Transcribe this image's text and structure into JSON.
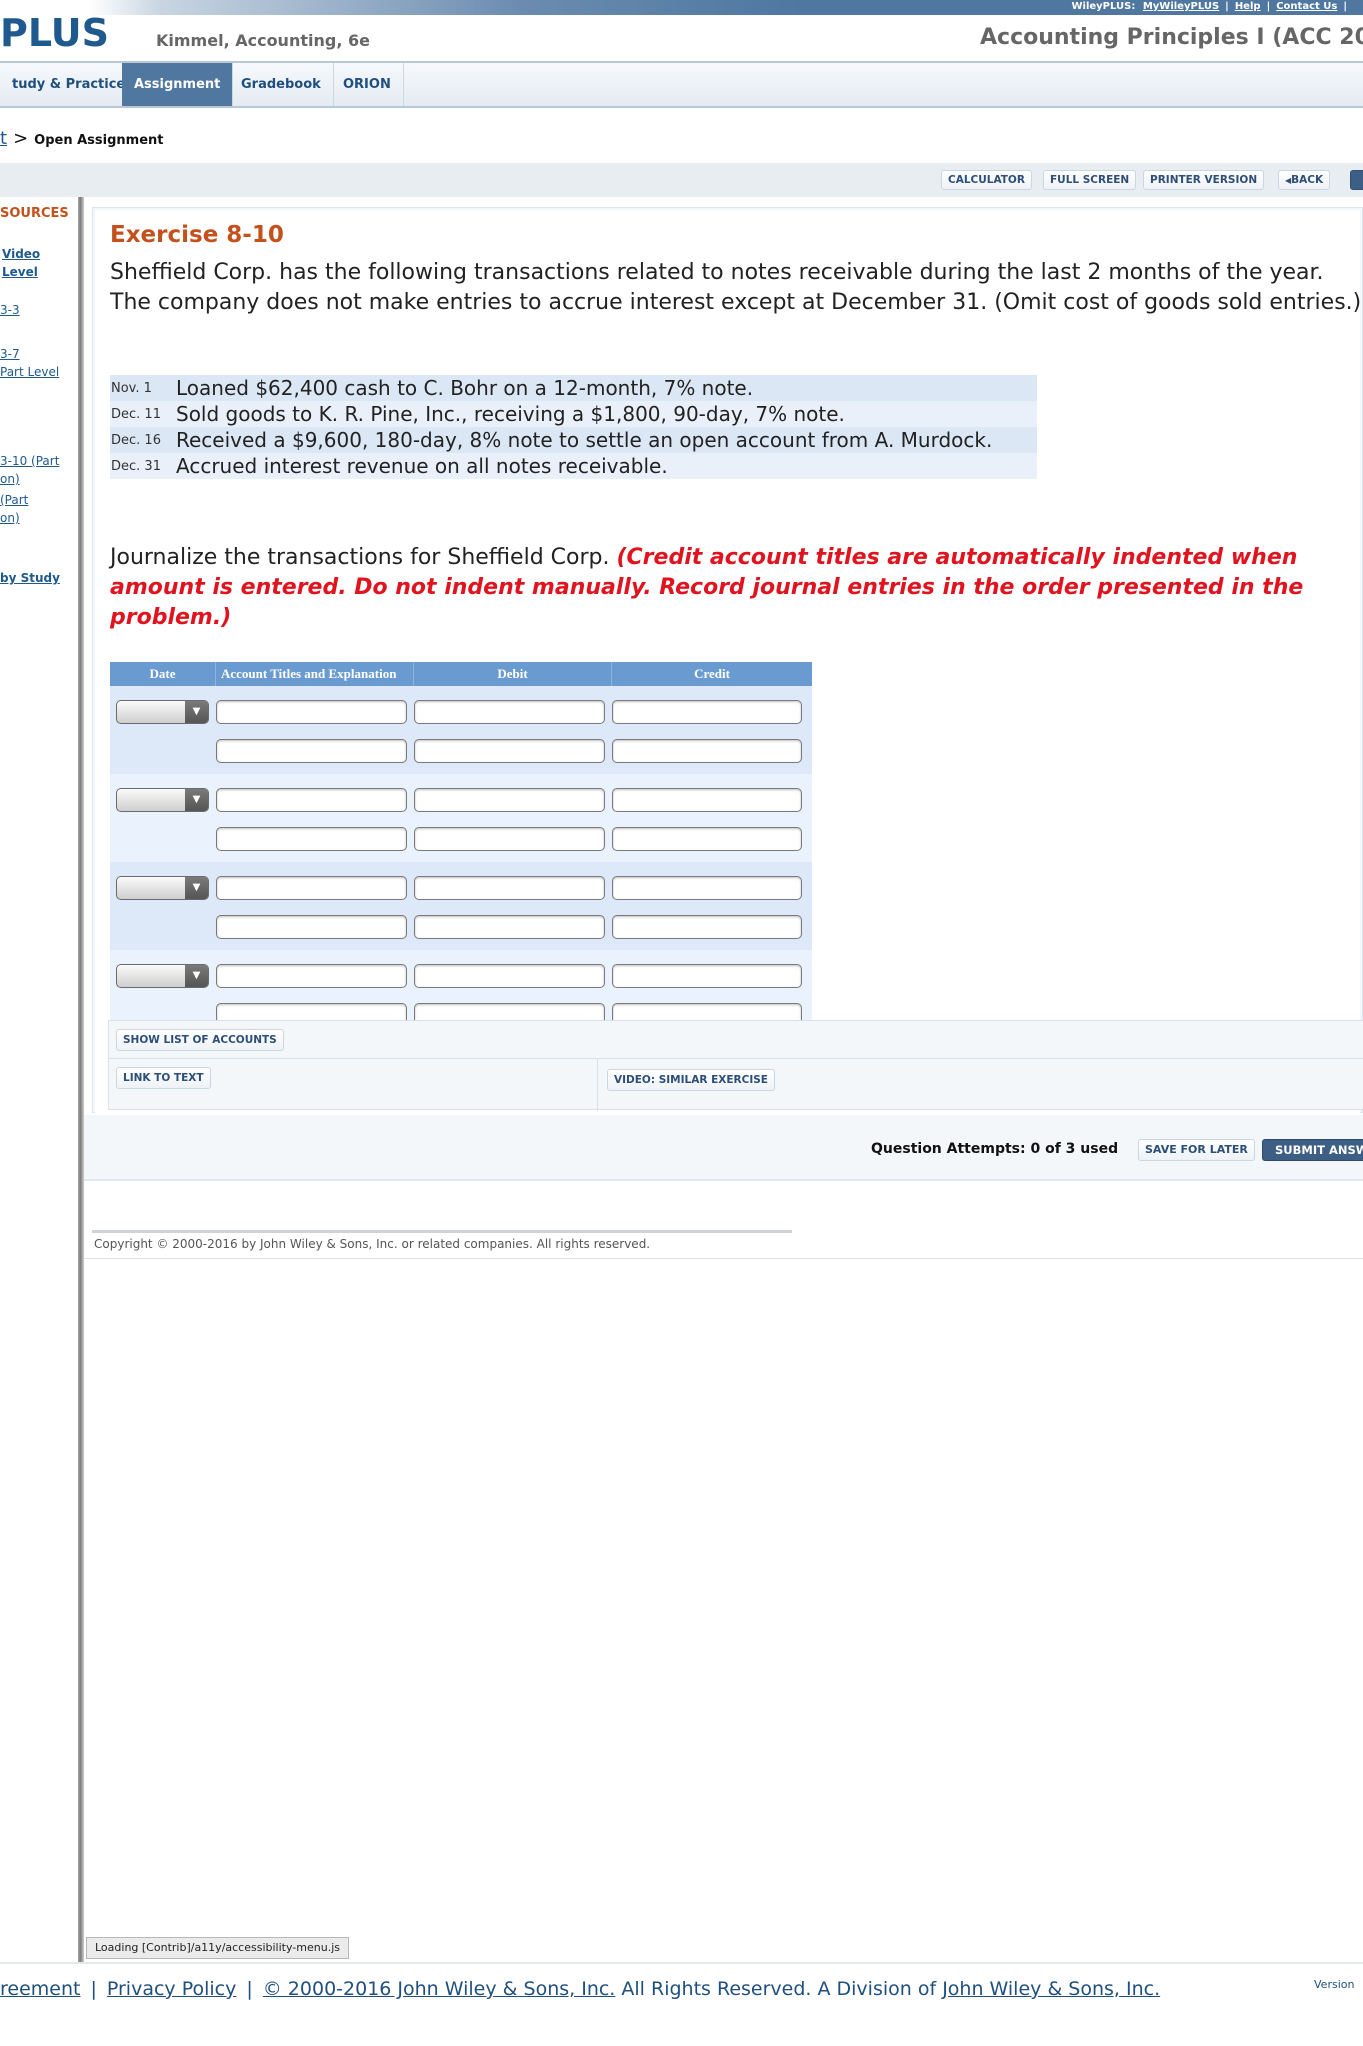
{
  "topbar": {
    "label": "WileyPLUS:",
    "links": [
      "MyWileyPLUS",
      "Help",
      "Contact Us"
    ]
  },
  "header": {
    "logo": "PLUS",
    "book_title": "Kimmel, Accounting, 6e",
    "course_title": "Accounting Principles I (ACC 20"
  },
  "nav": {
    "tabs": [
      {
        "label": "tudy & Practice",
        "active": false
      },
      {
        "label": "Assignment",
        "active": true
      },
      {
        "label": "Gradebook",
        "active": false
      },
      {
        "label": "ORION",
        "active": false
      }
    ]
  },
  "breadcrumb": {
    "parent": "t",
    "separator": ">",
    "current": "Open Assignment"
  },
  "toolbar": {
    "calculator": "CALCULATOR",
    "full_screen": "FULL SCREEN",
    "printer_version": "PRINTER VERSION",
    "back": "BACK",
    "back_icon": "◀"
  },
  "sidebar": {
    "heading": "SOURCES",
    "links": [
      {
        "lines": [
          "Video",
          "Level"
        ],
        "bold": true
      },
      {
        "lines": [
          "3-3"
        ],
        "bold": false
      },
      {
        "lines": [
          "3-7",
          "Part Level"
        ],
        "bold": false
      },
      {
        "lines": [
          "3-10 (Part",
          "on)"
        ],
        "bold": false
      },
      {
        "lines": [
          "(Part",
          "on)"
        ],
        "bold": false
      },
      {
        "lines": [
          "by Study"
        ],
        "bold": true
      }
    ]
  },
  "question": {
    "title": "Exercise 8-10",
    "intro": "Sheffield Corp. has the following transactions related to notes receivable during the last 2 months of the year. The company does not make entries to accrue interest except at December 31. (Omit cost of goods sold entries.)",
    "transactions": [
      {
        "date": "Nov. 1",
        "description": "Loaned $62,400 cash to C. Bohr on a 12-month, 7% note."
      },
      {
        "date": "Dec. 11",
        "description": "Sold goods to K. R. Pine, Inc., receiving a $1,800, 90-day, 7% note."
      },
      {
        "date": "Dec. 16",
        "description": "Received a $9,600, 180-day, 8% note to settle an open account from A. Murdock."
      },
      {
        "date": "Dec. 31",
        "description": "Accrued interest revenue on all notes receivable."
      }
    ],
    "instruction_plain": "Journalize the transactions for Sheffield Corp. ",
    "instruction_red": "(Credit account titles are automatically indented when amount is entered. Do not indent manually. Record journal entries in the order presented in the problem.)"
  },
  "journal": {
    "headers": {
      "date": "Date",
      "account": "Account Titles and Explanation",
      "debit": "Debit",
      "credit": "Credit"
    },
    "entries": [
      {
        "date": "",
        "rows": [
          {
            "account": "",
            "debit": "",
            "credit": ""
          },
          {
            "account": "",
            "debit": "",
            "credit": ""
          }
        ]
      },
      {
        "date": "",
        "rows": [
          {
            "account": "",
            "debit": "",
            "credit": ""
          },
          {
            "account": "",
            "debit": "",
            "credit": ""
          }
        ]
      },
      {
        "date": "",
        "rows": [
          {
            "account": "",
            "debit": "",
            "credit": ""
          },
          {
            "account": "",
            "debit": "",
            "credit": ""
          }
        ]
      },
      {
        "date": "",
        "rows": [
          {
            "account": "",
            "debit": "",
            "credit": ""
          },
          {
            "account": "",
            "debit": "",
            "credit": ""
          }
        ]
      }
    ]
  },
  "question_footer": {
    "show_accounts": "SHOW LIST OF ACCOUNTS",
    "link_to_text": "LINK TO TEXT",
    "video": "VIDEO: SIMILAR EXERCISE"
  },
  "attempts": {
    "text": "Question Attempts: 0 of 3 used",
    "save_for_later": "SAVE FOR LATER",
    "submit": "SUBMIT ANSW"
  },
  "copyright": "Copyright © 2000-2016 by John Wiley & Sons, Inc. or related companies. All rights reserved.",
  "loading": "Loading [Contrib]/a11y/accessibility-menu.js",
  "footer": {
    "agreement": "reement",
    "privacy": "Privacy Policy",
    "copyright_link": "© 2000-2016 John Wiley & Sons, Inc.",
    "rights_text": " All Rights Reserved. A Division of ",
    "division_link": "John Wiley & Sons, Inc.",
    "separator": "|",
    "version": "Version"
  }
}
